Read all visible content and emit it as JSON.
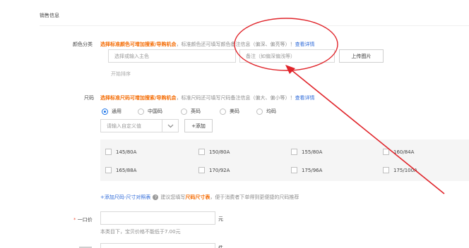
{
  "section": {
    "title": "销售信息"
  },
  "color": {
    "label": "颜色分类",
    "hint_highlight": "选择标准颜色可增加搜索/导购机会",
    "hint_text": "，标准颜色还可填写颜色备注信息（偏深、偏亮等）！",
    "hint_link": "查看详情",
    "main_placeholder": "选择或输入主色",
    "remark_placeholder": "备注（如偏深偏浅等）",
    "upload_button": "上传图片",
    "sort_text": "开始排序"
  },
  "size": {
    "label": "尺码",
    "hint_highlight": "选择标准尺码可增加搜索/导购机会",
    "hint_text": "，标准尺码还可填写尺码备注信息（偏大、偏小等）！",
    "hint_link": "查看详情",
    "options": [
      "通用",
      "中国码",
      "英码",
      "美码",
      "均码"
    ],
    "selected": "通用",
    "custom_placeholder": "请输入自定义值",
    "add_button": "+添加",
    "sizes_row1": [
      "145/80A",
      "150/80A",
      "155/80A",
      "160/84A"
    ],
    "sizes_row2": [
      "165/88A",
      "170/92A",
      "175/96A",
      "175/100A"
    ],
    "table_link": "+添加尺码-尺寸对照表",
    "tip_before": "建议您填写",
    "tip_highlight": "尺码尺寸表",
    "tip_after": "，便于消费者下单得到更便捷的尺码推荐"
  },
  "price": {
    "star": "*",
    "label": "一口价",
    "unit": "元",
    "note": "本类目下，宝贝价格不能低于7.00元"
  },
  "next": {
    "unit": "件"
  },
  "colors": {
    "annotation": "#e0242a",
    "accent": "#f46a00",
    "link": "#2e6ad9",
    "radio": "#1a73e8"
  }
}
